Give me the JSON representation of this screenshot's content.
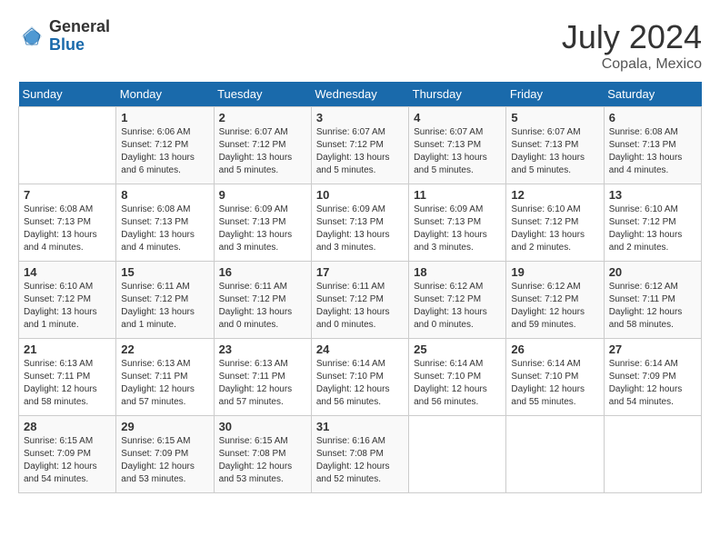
{
  "logo": {
    "general": "General",
    "blue": "Blue"
  },
  "title": {
    "month_year": "July 2024",
    "location": "Copala, Mexico"
  },
  "weekdays": [
    "Sunday",
    "Monday",
    "Tuesday",
    "Wednesday",
    "Thursday",
    "Friday",
    "Saturday"
  ],
  "weeks": [
    [
      {
        "day": "",
        "sunrise": "",
        "sunset": "",
        "daylight": ""
      },
      {
        "day": "1",
        "sunrise": "Sunrise: 6:06 AM",
        "sunset": "Sunset: 7:12 PM",
        "daylight": "Daylight: 13 hours and 6 minutes."
      },
      {
        "day": "2",
        "sunrise": "Sunrise: 6:07 AM",
        "sunset": "Sunset: 7:12 PM",
        "daylight": "Daylight: 13 hours and 5 minutes."
      },
      {
        "day": "3",
        "sunrise": "Sunrise: 6:07 AM",
        "sunset": "Sunset: 7:12 PM",
        "daylight": "Daylight: 13 hours and 5 minutes."
      },
      {
        "day": "4",
        "sunrise": "Sunrise: 6:07 AM",
        "sunset": "Sunset: 7:13 PM",
        "daylight": "Daylight: 13 hours and 5 minutes."
      },
      {
        "day": "5",
        "sunrise": "Sunrise: 6:07 AM",
        "sunset": "Sunset: 7:13 PM",
        "daylight": "Daylight: 13 hours and 5 minutes."
      },
      {
        "day": "6",
        "sunrise": "Sunrise: 6:08 AM",
        "sunset": "Sunset: 7:13 PM",
        "daylight": "Daylight: 13 hours and 4 minutes."
      }
    ],
    [
      {
        "day": "7",
        "sunrise": "Sunrise: 6:08 AM",
        "sunset": "Sunset: 7:13 PM",
        "daylight": "Daylight: 13 hours and 4 minutes."
      },
      {
        "day": "8",
        "sunrise": "Sunrise: 6:08 AM",
        "sunset": "Sunset: 7:13 PM",
        "daylight": "Daylight: 13 hours and 4 minutes."
      },
      {
        "day": "9",
        "sunrise": "Sunrise: 6:09 AM",
        "sunset": "Sunset: 7:13 PM",
        "daylight": "Daylight: 13 hours and 3 minutes."
      },
      {
        "day": "10",
        "sunrise": "Sunrise: 6:09 AM",
        "sunset": "Sunset: 7:13 PM",
        "daylight": "Daylight: 13 hours and 3 minutes."
      },
      {
        "day": "11",
        "sunrise": "Sunrise: 6:09 AM",
        "sunset": "Sunset: 7:13 PM",
        "daylight": "Daylight: 13 hours and 3 minutes."
      },
      {
        "day": "12",
        "sunrise": "Sunrise: 6:10 AM",
        "sunset": "Sunset: 7:12 PM",
        "daylight": "Daylight: 13 hours and 2 minutes."
      },
      {
        "day": "13",
        "sunrise": "Sunrise: 6:10 AM",
        "sunset": "Sunset: 7:12 PM",
        "daylight": "Daylight: 13 hours and 2 minutes."
      }
    ],
    [
      {
        "day": "14",
        "sunrise": "Sunrise: 6:10 AM",
        "sunset": "Sunset: 7:12 PM",
        "daylight": "Daylight: 13 hours and 1 minute."
      },
      {
        "day": "15",
        "sunrise": "Sunrise: 6:11 AM",
        "sunset": "Sunset: 7:12 PM",
        "daylight": "Daylight: 13 hours and 1 minute."
      },
      {
        "day": "16",
        "sunrise": "Sunrise: 6:11 AM",
        "sunset": "Sunset: 7:12 PM",
        "daylight": "Daylight: 13 hours and 0 minutes."
      },
      {
        "day": "17",
        "sunrise": "Sunrise: 6:11 AM",
        "sunset": "Sunset: 7:12 PM",
        "daylight": "Daylight: 13 hours and 0 minutes."
      },
      {
        "day": "18",
        "sunrise": "Sunrise: 6:12 AM",
        "sunset": "Sunset: 7:12 PM",
        "daylight": "Daylight: 13 hours and 0 minutes."
      },
      {
        "day": "19",
        "sunrise": "Sunrise: 6:12 AM",
        "sunset": "Sunset: 7:12 PM",
        "daylight": "Daylight: 12 hours and 59 minutes."
      },
      {
        "day": "20",
        "sunrise": "Sunrise: 6:12 AM",
        "sunset": "Sunset: 7:11 PM",
        "daylight": "Daylight: 12 hours and 58 minutes."
      }
    ],
    [
      {
        "day": "21",
        "sunrise": "Sunrise: 6:13 AM",
        "sunset": "Sunset: 7:11 PM",
        "daylight": "Daylight: 12 hours and 58 minutes."
      },
      {
        "day": "22",
        "sunrise": "Sunrise: 6:13 AM",
        "sunset": "Sunset: 7:11 PM",
        "daylight": "Daylight: 12 hours and 57 minutes."
      },
      {
        "day": "23",
        "sunrise": "Sunrise: 6:13 AM",
        "sunset": "Sunset: 7:11 PM",
        "daylight": "Daylight: 12 hours and 57 minutes."
      },
      {
        "day": "24",
        "sunrise": "Sunrise: 6:14 AM",
        "sunset": "Sunset: 7:10 PM",
        "daylight": "Daylight: 12 hours and 56 minutes."
      },
      {
        "day": "25",
        "sunrise": "Sunrise: 6:14 AM",
        "sunset": "Sunset: 7:10 PM",
        "daylight": "Daylight: 12 hours and 56 minutes."
      },
      {
        "day": "26",
        "sunrise": "Sunrise: 6:14 AM",
        "sunset": "Sunset: 7:10 PM",
        "daylight": "Daylight: 12 hours and 55 minutes."
      },
      {
        "day": "27",
        "sunrise": "Sunrise: 6:14 AM",
        "sunset": "Sunset: 7:09 PM",
        "daylight": "Daylight: 12 hours and 54 minutes."
      }
    ],
    [
      {
        "day": "28",
        "sunrise": "Sunrise: 6:15 AM",
        "sunset": "Sunset: 7:09 PM",
        "daylight": "Daylight: 12 hours and 54 minutes."
      },
      {
        "day": "29",
        "sunrise": "Sunrise: 6:15 AM",
        "sunset": "Sunset: 7:09 PM",
        "daylight": "Daylight: 12 hours and 53 minutes."
      },
      {
        "day": "30",
        "sunrise": "Sunrise: 6:15 AM",
        "sunset": "Sunset: 7:08 PM",
        "daylight": "Daylight: 12 hours and 53 minutes."
      },
      {
        "day": "31",
        "sunrise": "Sunrise: 6:16 AM",
        "sunset": "Sunset: 7:08 PM",
        "daylight": "Daylight: 12 hours and 52 minutes."
      },
      {
        "day": "",
        "sunrise": "",
        "sunset": "",
        "daylight": ""
      },
      {
        "day": "",
        "sunrise": "",
        "sunset": "",
        "daylight": ""
      },
      {
        "day": "",
        "sunrise": "",
        "sunset": "",
        "daylight": ""
      }
    ]
  ]
}
